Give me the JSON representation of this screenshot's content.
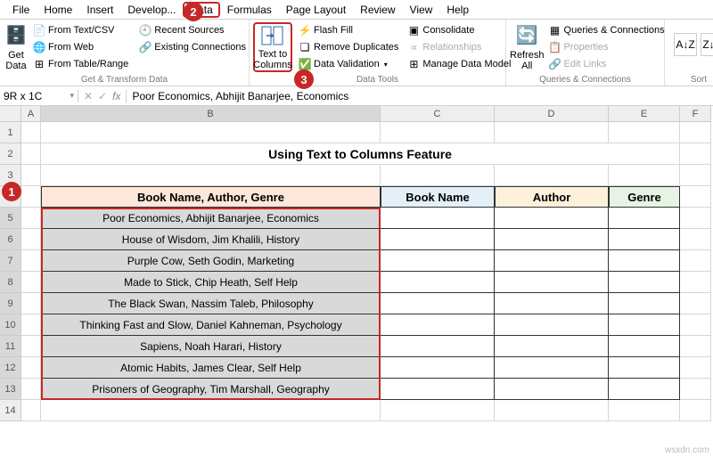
{
  "menubar": [
    "File",
    "Home",
    "Insert",
    "Develop...",
    "Data",
    "Formulas",
    "Page Layout",
    "Review",
    "View",
    "Help"
  ],
  "active_menu_index": 4,
  "ribbon": {
    "get_transform": {
      "get_data": "Get\nData",
      "from_textcsv": "From Text/CSV",
      "from_web": "From Web",
      "from_tablerange": "From Table/Range",
      "recent_sources": "Recent Sources",
      "existing_conn": "Existing Connections",
      "label": "Get & Transform Data"
    },
    "data_tools": {
      "text_to_columns": "Text to\nColumns",
      "flash_fill": "Flash Fill",
      "remove_dup": "Remove Duplicates",
      "data_validation": "Data Validation",
      "consolidate": "Consolidate",
      "relationships": "Relationships",
      "manage_model": "Manage Data Model",
      "label": "Data Tools"
    },
    "queries": {
      "refresh_all": "Refresh\nAll",
      "queries_conn": "Queries & Connections",
      "properties": "Properties",
      "edit_links": "Edit Links",
      "label": "Queries & Connections"
    },
    "sort": "Sort"
  },
  "namebox": "9R x 1C",
  "formula": "Poor Economics, Abhijit Banarjee, Economics",
  "cols": [
    "A",
    "B",
    "C",
    "D",
    "E",
    "F"
  ],
  "title": "Using Text to Columns Feature",
  "headers": {
    "b": "Book Name, Author, Genre",
    "c": "Book Name",
    "d": "Author",
    "e": "Genre"
  },
  "rows": [
    "Poor Economics, Abhijit Banarjee, Economics",
    "House of Wisdom, Jim Khalili, History",
    "Purple Cow, Seth Godin, Marketing",
    "Made to Stick, Chip Heath, Self Help",
    "The Black Swan, Nassim Taleb, Philosophy",
    "Thinking Fast and Slow, Daniel Kahneman, Psychology",
    "Sapiens, Noah Harari, History",
    "Atomic Habits, James Clear, Self Help",
    "Prisoners of Geography, Tim Marshall, Geography"
  ],
  "watermark": "wsxdn.com"
}
